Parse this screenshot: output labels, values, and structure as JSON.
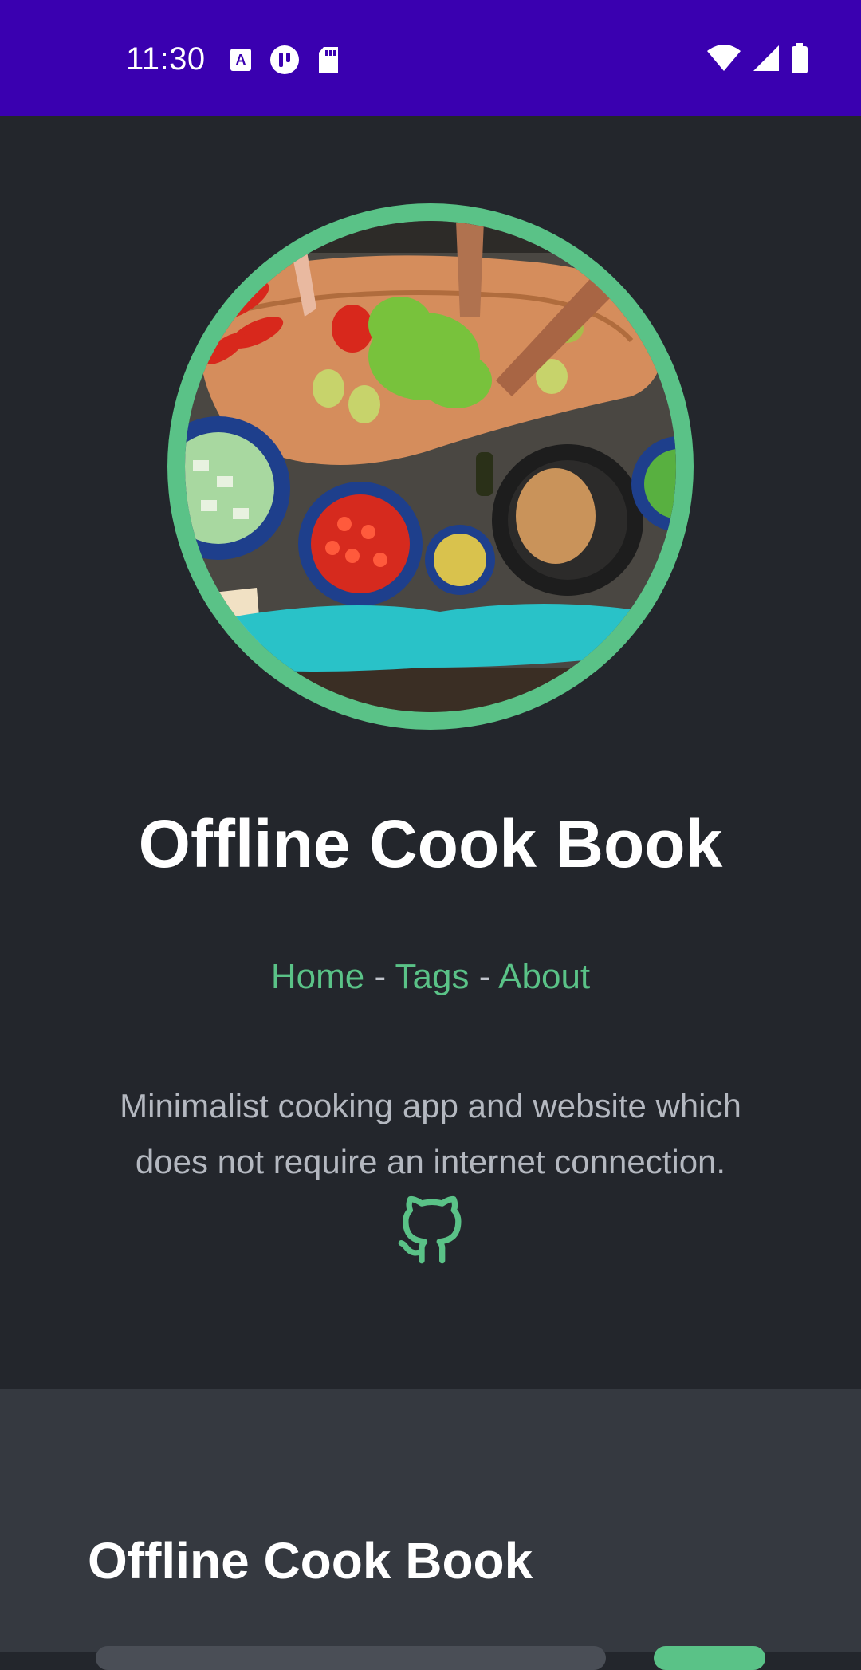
{
  "status_bar": {
    "time": "11:30",
    "left_icons": [
      "text-a-icon",
      "pause-icon",
      "sd-card-icon"
    ],
    "right_icons": [
      "wifi-icon",
      "cell-signal-icon",
      "battery-icon"
    ],
    "bg_color": "#3a00b0"
  },
  "hero": {
    "title": "Offline Cook Book",
    "nav": {
      "home": "Home",
      "separator1": " - ",
      "tags": "Tags",
      "separator2": " - ",
      "about": "About"
    },
    "description": "Minimalist cooking app and website which does not require an internet connection.",
    "github_icon": "github-icon",
    "accent_color": "#5ac287"
  },
  "section": {
    "title": "Offline Cook Book"
  }
}
